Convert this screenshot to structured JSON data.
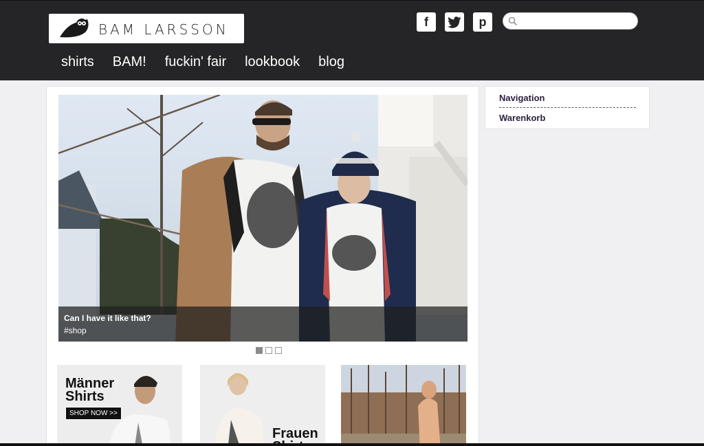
{
  "brand": {
    "name": "BAM LARSSON"
  },
  "nav": {
    "items": [
      "shirts",
      "BAM!",
      "fuckin' fair",
      "lookbook",
      "blog"
    ]
  },
  "social": {
    "facebook": "f",
    "twitter": "t",
    "pinterest": "p"
  },
  "search": {
    "placeholder": "",
    "value": ""
  },
  "sidebar": {
    "navigation": "Navigation",
    "cart": "Warenkorb"
  },
  "slider": {
    "caption_title": "Can I have it like that?",
    "caption_tag": "#shop",
    "dots": 3,
    "active_dot": 1
  },
  "tiles": {
    "men_title_1": "Männer",
    "men_title_2": "Shirts",
    "men_button": "SHOP NOW >>",
    "women_title_1": "Frauen",
    "women_title_2": "Shirts"
  },
  "colors": {
    "topbar": "#252527",
    "background": "#f0f0f2",
    "sidebar_link": "#2a1f3d"
  }
}
